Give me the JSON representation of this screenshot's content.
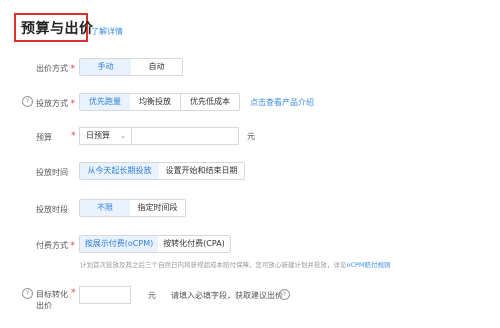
{
  "header": {
    "title": "预算与出价",
    "detail_link": "了解详情"
  },
  "bid_method": {
    "label": "出价方式",
    "options": [
      "手动",
      "自动"
    ],
    "selected": "手动"
  },
  "delivery_method": {
    "label": "投放方式",
    "options": [
      "优先跑量",
      "均衡投放",
      "优先低成本"
    ],
    "selected": "优先跑量",
    "link": "点击查看产品介绍"
  },
  "budget": {
    "label": "预算",
    "select_value": "日预算",
    "input_value": "",
    "unit": "元"
  },
  "delivery_time": {
    "label": "投放时间",
    "options": [
      "从今天起长期投放",
      "设置开始和结束日期"
    ],
    "selected": "从今天起长期投放"
  },
  "delivery_period": {
    "label": "投放时段",
    "options": [
      "不限",
      "指定时间段"
    ],
    "selected": "不限"
  },
  "billing": {
    "label": "付费方式",
    "options": [
      "按展示付费(oCPM)",
      "按转化付费(CPA)"
    ],
    "selected": "按展示付费(oCPM)",
    "note": "计划首次投放及其之后三个自然日内将获得超成本赔付保障，您可放心新建计划并投放，详见",
    "note_link": "oCPM赔付规则"
  },
  "target_cost": {
    "label_line1": "目标转化",
    "label_line2": "出价",
    "input_value": "",
    "unit": "元",
    "hint": "请填入必填字段，获取建议出价"
  },
  "required_mark": "*",
  "help_glyph": "?",
  "colors": {
    "accent": "#2f7fd8",
    "required": "#e5392f",
    "highlight_box": "#d9322b"
  }
}
